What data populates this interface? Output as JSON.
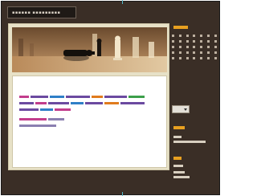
{
  "nav": {
    "items": [
      "▪▪▪▪▪▪ ▪▪▪▪▪▪▪▪▪"
    ]
  },
  "post": {
    "title": "",
    "body": "",
    "meta": ""
  },
  "sidebar": {
    "calendar_title": "",
    "search_title": "",
    "links_title": "",
    "links": []
  },
  "colors": {
    "background": "#3a2e26",
    "panel": "#e7e1c7",
    "accent": "#e8a020",
    "link": "#6b4aa0"
  },
  "hero_image": "chess-pieces-photo"
}
